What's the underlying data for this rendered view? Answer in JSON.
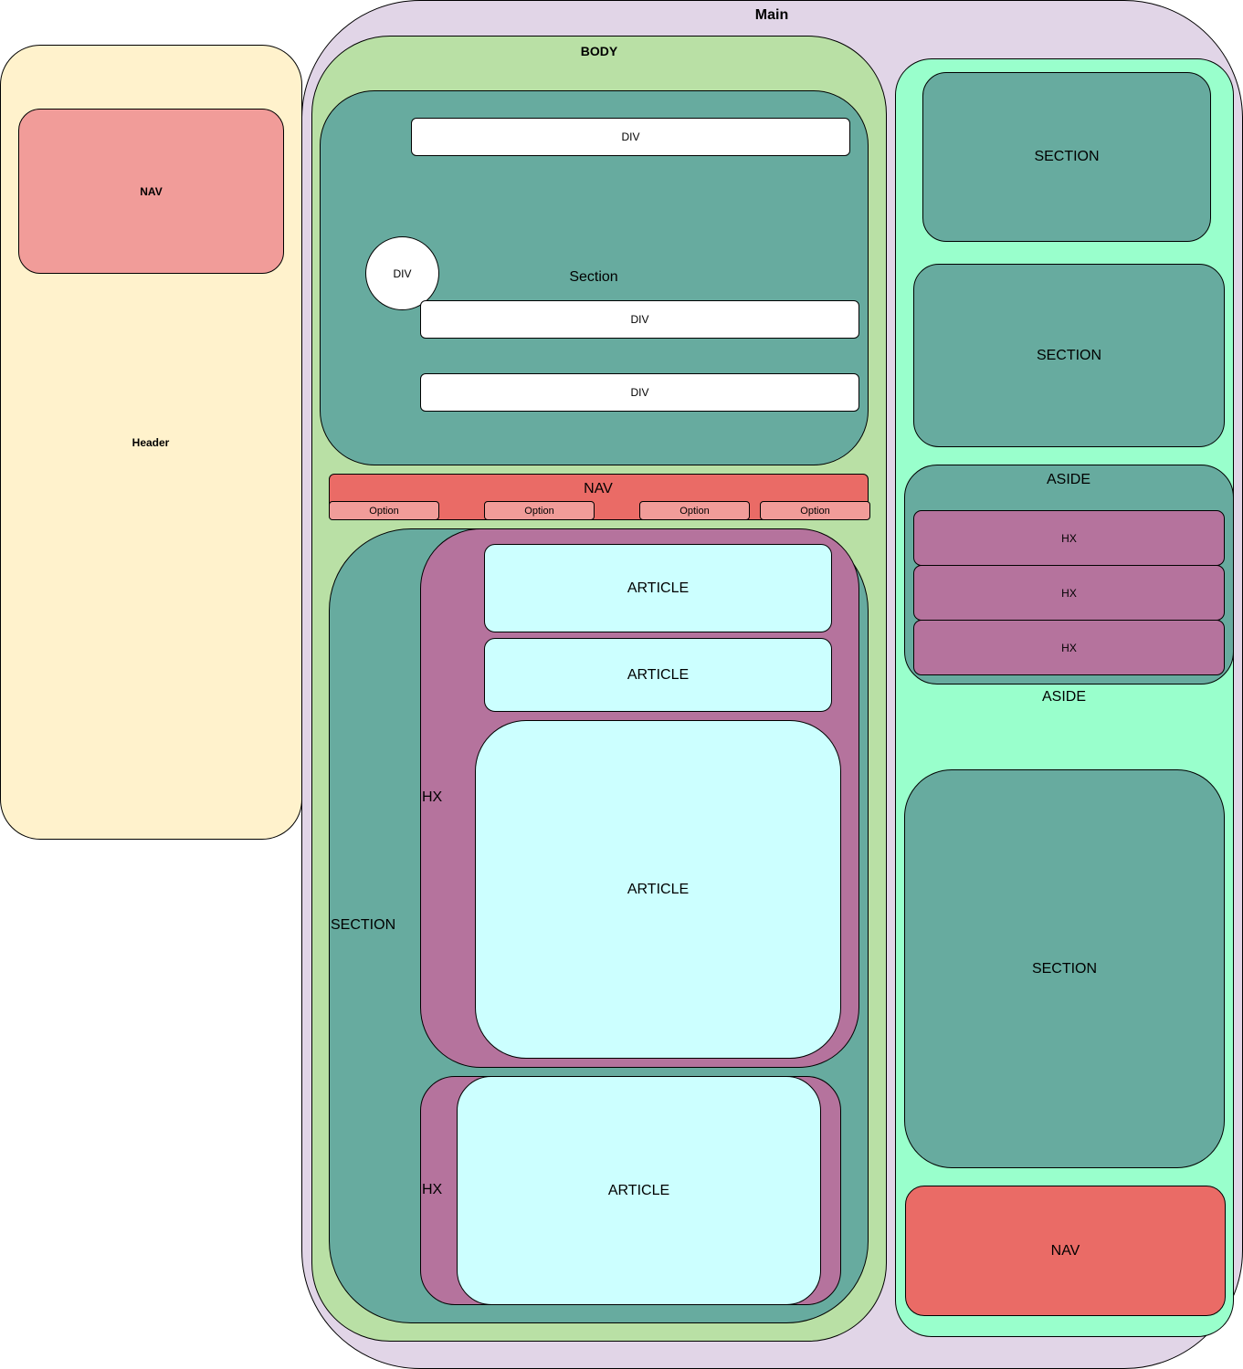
{
  "main": {
    "label": "Main"
  },
  "header": {
    "label": "Header",
    "nav_label": "NAV"
  },
  "body": {
    "label": "BODY",
    "top_section": {
      "label": "Section",
      "divs": [
        "DIV",
        "DIV",
        "DIV"
      ],
      "circle_div": "DIV"
    },
    "nav": {
      "label": "NAV",
      "options": [
        "Option",
        "Option",
        "Option",
        "Option"
      ]
    },
    "section": {
      "label": "SECTION",
      "hx_large": {
        "label": "HX",
        "articles": [
          "ARTICLE",
          "ARTICLE",
          "ARTICLE"
        ]
      },
      "hx_small": {
        "label": "HX",
        "article": "ARTICLE"
      }
    }
  },
  "aside_column": {
    "sections": [
      "SECTION",
      "SECTION"
    ],
    "aside_inner": {
      "label": "ASIDE",
      "hx_items": [
        "HX",
        "HX",
        "HX"
      ]
    },
    "aside_label": "ASIDE",
    "bottom_section": "SECTION",
    "nav": "NAV"
  }
}
